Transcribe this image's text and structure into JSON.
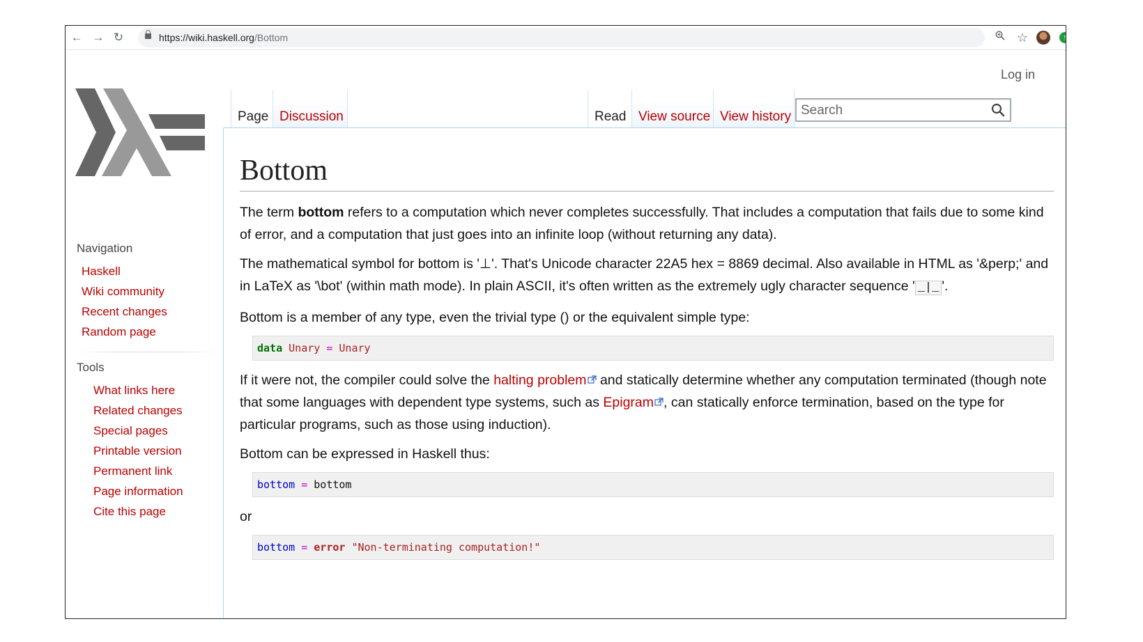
{
  "browser": {
    "url_host": "https://wiki.haskell.org",
    "url_path": "/Bottom",
    "back_icon": "←",
    "forward_icon": "→",
    "reload_icon": "↻",
    "zoom_icon": "🔍",
    "star_icon": "☆",
    "extension_icon": "↑"
  },
  "header": {
    "login": "Log in"
  },
  "sidebar": {
    "navigation_heading": "Navigation",
    "navigation": [
      "Haskell",
      "Wiki community",
      "Recent changes",
      "Random page"
    ],
    "tools_heading": "Tools",
    "tools": [
      "What links here",
      "Related changes",
      "Special pages",
      "Printable version",
      "Permanent link",
      "Page information",
      "Cite this page"
    ]
  },
  "tabs": {
    "page": "Page",
    "discussion": "Discussion",
    "read": "Read",
    "view_source": "View source",
    "view_history": "View history"
  },
  "search": {
    "placeholder": "Search"
  },
  "article": {
    "title": "Bottom",
    "p1_a": "The term ",
    "p1_bold": "bottom",
    "p1_b": " refers to a computation which never completes successfully. That includes a computation that fails due to some kind of error, and a computation that just goes into an infinite loop (without returning any data).",
    "p2_a": "The mathematical symbol for bottom is '⊥'. That's Unicode character 22A5 hex = 8869 decimal. Also available in HTML as '&perp;' and in LaTeX as '\\bot' (within math mode). In plain ASCII, it's often written as the extremely ugly character sequence '",
    "p2_code": "_|_",
    "p2_b": "'.",
    "p3": "Bottom is a member of any type, even the trivial type () or the equivalent simple type:",
    "code1": {
      "kw": "data",
      "type": "Unary",
      "op": "=",
      "con": "Unary"
    },
    "p4_a": "If it were not, the compiler could solve the ",
    "p4_link1": "halting problem",
    "p4_b": " and statically determine whether any computation terminated (though note that some languages with dependent type systems, such as ",
    "p4_link2": "Epigram",
    "p4_c": ", can statically enforce termination, based on the type for particular programs, such as those using induction).",
    "p5": "Bottom can be expressed in Haskell thus:",
    "code2": {
      "fn": "bottom",
      "op": "=",
      "var": "bottom"
    },
    "p6": "or",
    "code3": {
      "fn": "bottom",
      "op": "=",
      "err": "error",
      "str": "\"Non-terminating computation!\""
    }
  },
  "colors": {
    "link": "#ba0000",
    "border_blue": "#a7d7f9",
    "logo_dark": "#666666",
    "logo_light": "#999999"
  }
}
